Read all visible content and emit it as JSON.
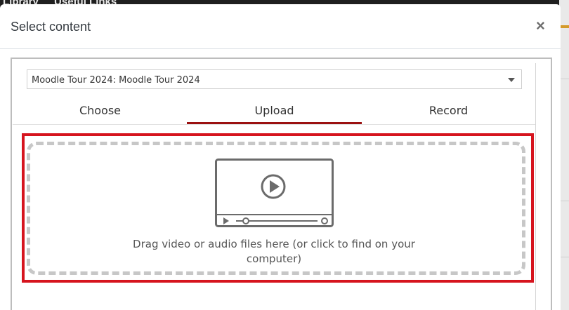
{
  "background_nav": {
    "items": [
      "Library",
      "Useful Links"
    ]
  },
  "modal": {
    "title": "Select content",
    "close_label": "×"
  },
  "course_select": {
    "value": "Moodle Tour 2024: Moodle Tour 2024"
  },
  "tabs": [
    {
      "label": "Choose",
      "active": false
    },
    {
      "label": "Upload",
      "active": true
    },
    {
      "label": "Record",
      "active": false
    }
  ],
  "dropzone": {
    "text": "Drag video or audio files here (or click to find on your computer)",
    "icon": "video-player-icon"
  },
  "colors": {
    "active_tab": "#9b1111",
    "highlight_border": "#d6141e"
  }
}
